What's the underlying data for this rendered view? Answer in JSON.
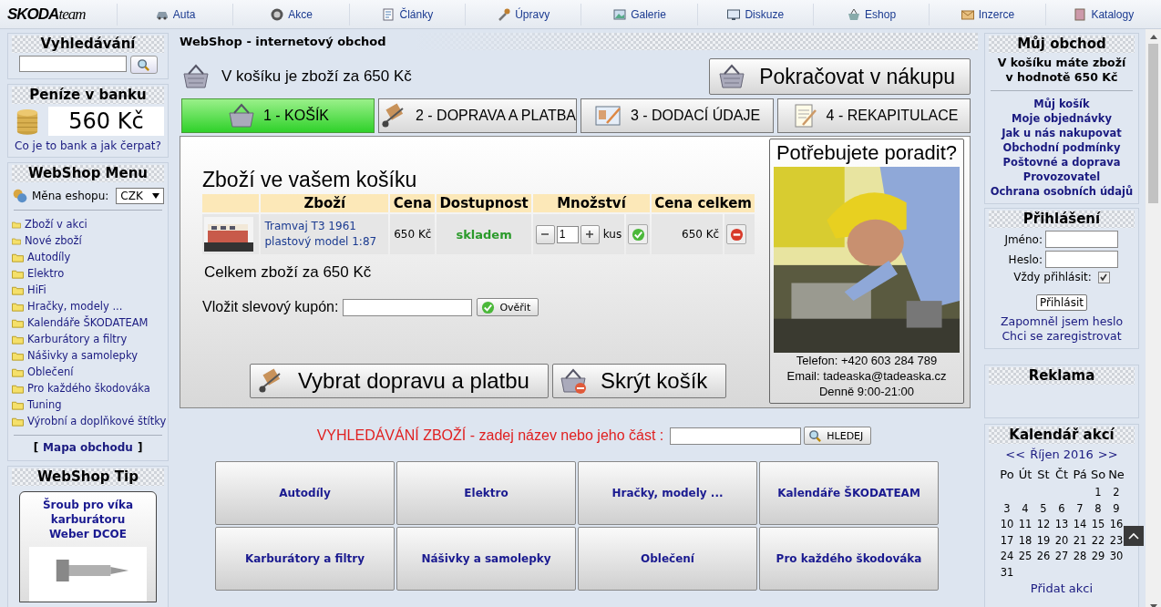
{
  "nav": {
    "logo": {
      "main": "SKODA",
      "sub": "team"
    },
    "items": [
      {
        "label": "Auta",
        "kind": "car"
      },
      {
        "label": "Akce",
        "kind": "wheel"
      },
      {
        "label": "Články",
        "kind": "article"
      },
      {
        "label": "Úpravy",
        "kind": "wrench"
      },
      {
        "label": "Galerie",
        "kind": "gallery"
      },
      {
        "label": "Diskuze",
        "kind": "screen"
      },
      {
        "label": "Eshop",
        "kind": "basket"
      },
      {
        "label": "Inzerce",
        "kind": "envelope"
      },
      {
        "label": "Katalogy",
        "kind": "book"
      }
    ]
  },
  "left": {
    "search": {
      "title": "Vyhledávání"
    },
    "bank": {
      "title": "Peníze v banku",
      "amount": "560 Kč",
      "link": "Co je to bank a jak čerpat?"
    },
    "menu": {
      "title": "WebShop Menu",
      "currency_label": "Měna eshopu:",
      "currency": "CZK",
      "special": [
        "Zboží v akci",
        "Nové zboží"
      ],
      "categories": [
        "Autodíly",
        "Elektro",
        "HiFi",
        "Hračky, modely ...",
        "Kalendáře ŠKODATEAM",
        "Karburátory a filtry",
        "Nášivky a samolepky",
        "Oblečení",
        "Pro každého škodováka",
        "Tuning",
        "Výrobní a doplňkové štítky"
      ],
      "map_open": "[",
      "map_link": "Mapa obchodu",
      "map_close": "]"
    },
    "tip": {
      "title": "WebShop Tip",
      "product": "Šroub pro víka karburátoru Weber DCOE"
    }
  },
  "main": {
    "title": "WebShop - internetový obchod",
    "cart_summary": "V košíku je zboží za 650 Kč",
    "continue_button": "Pokračovat v nákupu",
    "steps": [
      {
        "label": "1 - KOŠÍK",
        "kind": "basket",
        "selected": true
      },
      {
        "label": "2 - DOPRAVA A PLATBA",
        "kind": "cart",
        "selected": false
      },
      {
        "label": "3 - DODACÍ ÚDAJE",
        "kind": "form",
        "selected": false
      },
      {
        "label": "4 - REKAPITULACE",
        "kind": "notepad",
        "selected": false
      }
    ],
    "cart": {
      "heading": "Zboží ve vašem košíku",
      "columns": [
        "Zboží",
        "Cena",
        "Dostupnost",
        "Množství",
        "Cena celkem"
      ],
      "rows": [
        {
          "name": "Tramvaj T3 1961 plastový model 1:87",
          "price": "650 Kč",
          "availability": "skladem",
          "quantity": "1",
          "unit": "kus",
          "total": "650 Kč"
        }
      ],
      "total": "Celkem zboží za 650 Kč",
      "coupon_label": "Vložit slevový kupón:",
      "coupon_button": "Ověřit",
      "shipping_button": "Vybrat dopravu a platbu",
      "hide_button": "Skrýt košík"
    },
    "advice": {
      "title": "Potřebujete poradit?",
      "phone": "Telefon: +420 603 284 789",
      "email": "Email: tadeaska@tadeaska.cz",
      "hours": "Denně 9:00-21:00"
    },
    "product_search": {
      "label": "VYHLEDÁVÁNÍ ZBOŽÍ - zadej název nebo jeho část :",
      "button": "HLEDEJ"
    },
    "category_tiles": [
      "Autodíly",
      "Elektro",
      "Hračky, modely ...",
      "Kalendáře ŠKODATEAM",
      "Karburátory a filtry",
      "Nášivky a samolepky",
      "Oblečení",
      "Pro každého škodováka"
    ]
  },
  "right": {
    "shop": {
      "title": "Můj obchod",
      "summary_line1": "V košíku máte zboží",
      "summary_line2": "v hodnotě 650 Kč",
      "links": [
        "Můj košík",
        "Moje objednávky",
        "Jak u nás nakupovat",
        "Obchodní podmínky",
        "Poštovné a doprava",
        "Provozovatel",
        "Ochrana osobních údajů"
      ]
    },
    "login": {
      "title": "Přihlášení",
      "name_label": "Jméno:",
      "password_label": "Heslo:",
      "remember_label": "Vždy přihlásit:",
      "remember": true,
      "button": "Přihlásit",
      "forgot": "Zapomněl jsem heslo",
      "register": "Chci se zaregistrovat"
    },
    "ads": {
      "title": "Reklama"
    },
    "calendar": {
      "title": "Kalendář akcí",
      "prev": "<<",
      "month": "Říjen 2016",
      "next": ">>",
      "weekdays": [
        "Po",
        "Út",
        "St",
        "Čt",
        "Pá",
        "So",
        "Ne"
      ],
      "weeks": [
        {
          "kind": "end",
          "days": [
            "1",
            "2"
          ]
        },
        {
          "kind": "full",
          "days": [
            "3",
            "4",
            "5",
            "6",
            "7",
            "8",
            "9"
          ]
        },
        {
          "kind": "full",
          "days": [
            "10",
            "11",
            "12",
            "13",
            "14",
            "15",
            "16"
          ]
        },
        {
          "kind": "full",
          "days": [
            "17",
            "18",
            "19",
            "20",
            "21",
            "22",
            "23"
          ]
        },
        {
          "kind": "full",
          "days": [
            "24",
            "25",
            "26",
            "27",
            "28",
            "29",
            "30"
          ]
        },
        {
          "kind": "start",
          "days": [
            "31"
          ]
        }
      ],
      "add_link": "Přidat akci"
    }
  }
}
